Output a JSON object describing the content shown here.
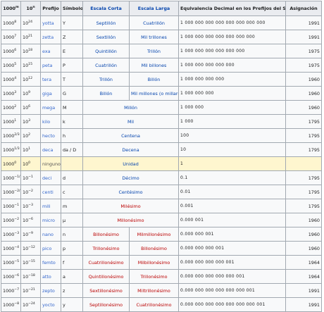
{
  "headers": {
    "pow": "1000",
    "pow_exp": "m",
    "sci": "10",
    "sci_exp": "n",
    "prefix": "Prefijo",
    "symbol": "Símbolo",
    "short": "Escala Corta",
    "long": "Escala Larga",
    "decimal": "Equivalencia Decimal en los Prefijos del SI",
    "year": "Asignación"
  },
  "rows": [
    {
      "pow": "1000",
      "pow_exp": "8",
      "sci": "10",
      "sci_exp": "24",
      "prefix": "yotta",
      "symbol": "Y",
      "short": "Septillón",
      "long": "Cuatrillón",
      "decimal": "1 000 000 000 000 000 000 000 000",
      "year": "1991",
      "hl": false
    },
    {
      "pow": "1000",
      "pow_exp": "7",
      "sci": "10",
      "sci_exp": "21",
      "prefix": "zetta",
      "symbol": "Z",
      "short": "Sextillón",
      "long": "Mil trillones",
      "decimal": "1 000 000 000 000 000 000 000",
      "year": "1991",
      "hl": false
    },
    {
      "pow": "1000",
      "pow_exp": "6",
      "sci": "10",
      "sci_exp": "18",
      "prefix": "exa",
      "symbol": "E",
      "short": "Quintillón",
      "long": "Trillón",
      "decimal": "1 000 000 000 000 000 000",
      "year": "1975",
      "hl": false
    },
    {
      "pow": "1000",
      "pow_exp": "5",
      "sci": "10",
      "sci_exp": "15",
      "prefix": "peta",
      "symbol": "P",
      "short": "Cuatrillón",
      "long": "Mil billones",
      "decimal": "1 000 000 000 000 000",
      "year": "1975",
      "hl": false
    },
    {
      "pow": "1000",
      "pow_exp": "4",
      "sci": "10",
      "sci_exp": "12",
      "prefix": "tera",
      "symbol": "T",
      "short": "Trillón",
      "long": "Billón",
      "decimal": "1 000 000 000 000",
      "year": "1960",
      "hl": false
    },
    {
      "pow": "1000",
      "pow_exp": "3",
      "sci": "10",
      "sci_exp": "9",
      "prefix": "giga",
      "symbol": "G",
      "short": "Billón",
      "long": "Mil millones (o millardo)",
      "decimal": "1 000 000 000",
      "year": "1960",
      "hl": false
    },
    {
      "pow": "1000",
      "pow_exp": "2",
      "sci": "10",
      "sci_exp": "6",
      "prefix": "mega",
      "symbol": "M",
      "short": "",
      "long": "Millón",
      "decimal": "1 000 000",
      "year": "1960",
      "hl": false
    },
    {
      "pow": "1000",
      "pow_exp": "1",
      "sci": "10",
      "sci_exp": "3",
      "prefix": "kilo",
      "symbol": "k",
      "short": "",
      "long": "Mil",
      "decimal": "1 000",
      "year": "1795",
      "hl": false
    },
    {
      "pow": "1000",
      "pow_exp": "2/3",
      "sci": "10",
      "sci_exp": "2",
      "prefix": "hecto",
      "symbol": "h",
      "short": "",
      "long": "Centena",
      "decimal": "100",
      "year": "1795",
      "hl": false
    },
    {
      "pow": "1000",
      "pow_exp": "1/3",
      "sci": "10",
      "sci_exp": "1",
      "prefix": "deca",
      "symbol": "da / D",
      "short": "",
      "long": "Decena",
      "decimal": "10",
      "year": "1795",
      "hl": false
    },
    {
      "pow": "1000",
      "pow_exp": "0",
      "sci": "10",
      "sci_exp": "0",
      "prefix": "ninguno",
      "symbol": "",
      "short": "",
      "long": "Unidad",
      "decimal": "1",
      "year": "",
      "hl": true
    },
    {
      "pow": "1000",
      "pow_exp": "−1/3",
      "sci": "10",
      "sci_exp": "−1",
      "prefix": "deci",
      "symbol": "d",
      "short": "",
      "long": "Décimo",
      "decimal": "0.1",
      "year": "1795",
      "hl": false
    },
    {
      "pow": "1000",
      "pow_exp": "−2/3",
      "sci": "10",
      "sci_exp": "−2",
      "prefix": "centi",
      "symbol": "c",
      "short": "",
      "long": "Centésimo",
      "decimal": "0.01",
      "year": "1795",
      "hl": false
    },
    {
      "pow": "1000",
      "pow_exp": "−1",
      "sci": "10",
      "sci_exp": "−3",
      "prefix": "mili",
      "symbol": "m",
      "short": "",
      "long": "Milésimo",
      "decimal": "0.001",
      "year": "1795",
      "hl": false
    },
    {
      "pow": "1000",
      "pow_exp": "−2",
      "sci": "10",
      "sci_exp": "−6",
      "prefix": "micro",
      "symbol": "µ",
      "short": "",
      "long": "Millonésimo",
      "decimal": "0.000 001",
      "year": "1960",
      "hl": false
    },
    {
      "pow": "1000",
      "pow_exp": "−3",
      "sci": "10",
      "sci_exp": "−9",
      "prefix": "nano",
      "symbol": "n",
      "short": "Billonésimo",
      "long": "Milmillonésimo",
      "decimal": "0.000 000 001",
      "year": "1960",
      "hl": false
    },
    {
      "pow": "1000",
      "pow_exp": "−4",
      "sci": "10",
      "sci_exp": "−12",
      "prefix": "pico",
      "symbol": "p",
      "short": "Trillonésimo",
      "long": "Billonésimo",
      "decimal": "0.000 000 000 001",
      "year": "1960",
      "hl": false
    },
    {
      "pow": "1000",
      "pow_exp": "−5",
      "sci": "10",
      "sci_exp": "−15",
      "prefix": "femto",
      "symbol": "f",
      "short": "Cuatrillonésimo",
      "long": "Milbillonésimo",
      "decimal": "0.000 000 000 000 001",
      "year": "1964",
      "hl": false
    },
    {
      "pow": "1000",
      "pow_exp": "−6",
      "sci": "10",
      "sci_exp": "−18",
      "prefix": "atto",
      "symbol": "a",
      "short": "Quintillonésimo",
      "long": "Trillonésimo",
      "decimal": "0.000 000 000 000 000 001",
      "year": "1964",
      "hl": false
    },
    {
      "pow": "1000",
      "pow_exp": "−7",
      "sci": "10",
      "sci_exp": "−21",
      "prefix": "zepto",
      "symbol": "z",
      "short": "Sextillonésimo",
      "long": "Miltrillonésimo",
      "decimal": "0.000 000 000 000 000 000 001",
      "year": "1991",
      "hl": false
    },
    {
      "pow": "1000",
      "pow_exp": "−8",
      "sci": "10",
      "sci_exp": "−24",
      "prefix": "yocto",
      "symbol": "y",
      "short": "Septillonésimo",
      "long": "Cuatrillonésimo",
      "decimal": "0.000 000 000 000 000 000 000 001",
      "year": "1991",
      "hl": false
    }
  ]
}
